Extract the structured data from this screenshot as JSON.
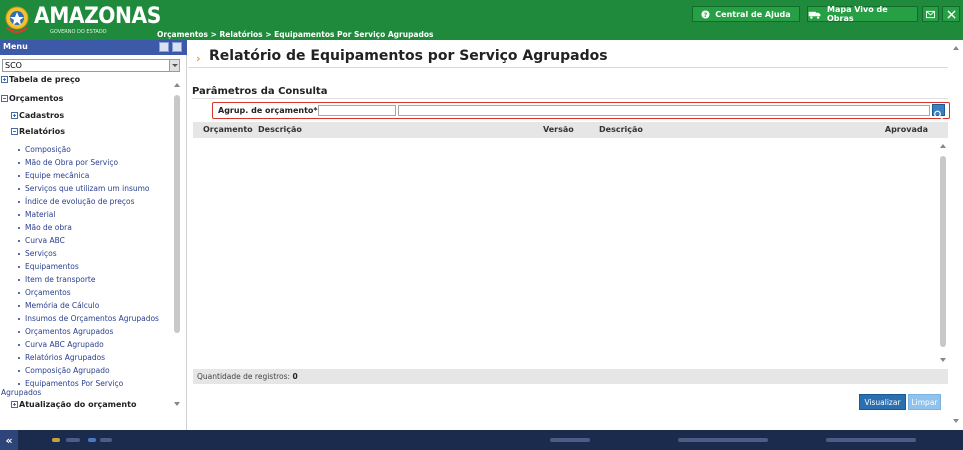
{
  "header": {
    "logo_title": "AMAZONAS",
    "logo_subtitle": "GOVERNO DO ESTADO",
    "breadcrumb": "Orçamentos > Relatórios > Equipamentos Por Serviço Agrupados",
    "help_button": "Central de Ajuda",
    "map_button": "Mapa Vivo de Obras",
    "brand_color": "#1f8a3b"
  },
  "sidebar": {
    "menu_label": "Menu",
    "system_select": "SCO",
    "tree": {
      "tabela": "Tabela de preço",
      "orcamentos": "Orçamentos",
      "cadastros": "Cadastros",
      "relatorios": "Relatórios",
      "atualizacao": "Atualização do orçamento"
    },
    "reports": [
      "Composição",
      "Mão de Obra por Serviço",
      "Equipe mecânica",
      "Serviços que utilizam um insumo",
      "Índice de evolução de preços",
      "Material",
      "Mão de obra",
      "Curva ABC",
      "Serviços",
      "Equipamentos",
      "Item de transporte",
      "Orçamentos",
      "Memória de Cálculo",
      "Insumos de Orçamentos Agrupados",
      "Orçamentos Agrupados",
      "Curva ABC Agrupado",
      "Relatórios Agrupados",
      "Composição Agrupado"
    ],
    "last_report_line1": "Equipamentos Por Serviço",
    "last_report_line2": "Agrupados"
  },
  "main": {
    "page_title": "Relatório de Equipamentos por Serviço Agrupados",
    "section_title": "Parâmetros da Consulta",
    "param_label": "Agrup. de orçamento*:",
    "param_code_value": "",
    "param_desc_value": "",
    "table_columns": [
      "Orçamento",
      "Descrição",
      "Versão",
      "Descrição",
      "Aprovada"
    ],
    "records_label": "Quantidade de registros:",
    "records_count": "0",
    "visualizar_button": "Visualizar",
    "limpar_button": "Limpar"
  },
  "footer": {
    "collapse_label": "«"
  }
}
